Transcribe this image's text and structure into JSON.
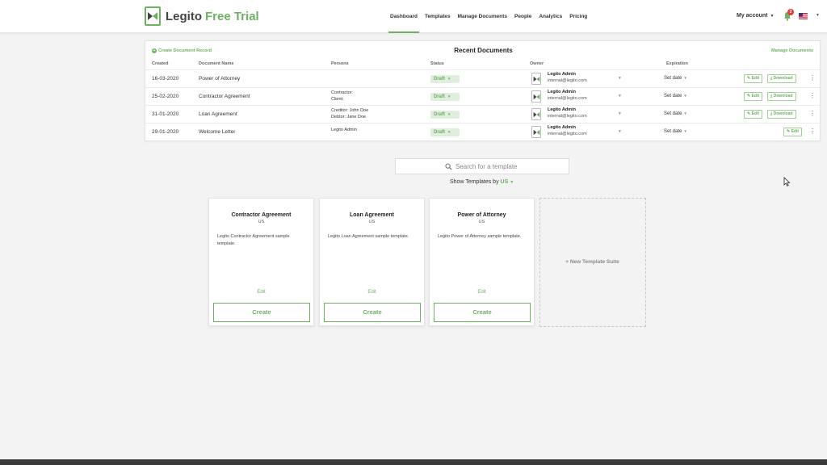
{
  "brand": {
    "name": "Legito",
    "suffix": "Free Trial"
  },
  "nav": [
    "Dashboard",
    "Templates",
    "Manage Documents",
    "People",
    "Analytics",
    "Pricing"
  ],
  "account": {
    "label": "My account",
    "notifications": "2"
  },
  "documents": {
    "create_label": "Create Document Record",
    "title": "Recent Documents",
    "manage_label": "Manage Documents",
    "columns": [
      "Created",
      "Document Name",
      "Persons",
      "Status",
      "Owner",
      "Expiration"
    ],
    "rows": [
      {
        "created": "16-03-2020",
        "name": "Power of Attorney",
        "persons": [
          "",
          ""
        ],
        "status": "Draft",
        "owner": "Legito Admin",
        "email": "internal@legito.com",
        "expiration": "Set date",
        "edit": "Edit",
        "download": "Download"
      },
      {
        "created": "25-02-2020",
        "name": "Contractor Agreement",
        "persons": [
          "Contractor:",
          "Client:"
        ],
        "status": "Draft",
        "owner": "Legito Admin",
        "email": "internal@legito.com",
        "expiration": "Set date",
        "edit": "Edit",
        "download": "Download"
      },
      {
        "created": "31-01-2020",
        "name": "Loan Agreement",
        "persons": [
          "Creditor: John Doe",
          "Debtor: Jane Doe"
        ],
        "status": "Draft",
        "owner": "Legito Admin",
        "email": "internal@legito.com",
        "expiration": "Set date",
        "edit": "Edit",
        "download": "Download"
      },
      {
        "created": "29-01-2020",
        "name": "Welcome Letter",
        "persons": [
          "Legito Admin",
          ""
        ],
        "status": "Draft",
        "owner": "Legito Admin",
        "email": "internal@legito.com",
        "expiration": "Set date",
        "edit": "Edit"
      }
    ]
  },
  "search": {
    "placeholder": "Search for a template"
  },
  "show_templates": {
    "label": "Show Templates by",
    "value": "US"
  },
  "templates": [
    {
      "title": "Contractor Agreement",
      "country": "US",
      "description": "Legito Contractor Agreement sample template.",
      "edit": "Edit",
      "create": "Create"
    },
    {
      "title": "Loan Agreement",
      "country": "US",
      "description": "Legito Loan Agreement sample template.",
      "edit": "Edit",
      "create": "Create"
    },
    {
      "title": "Power of Attorney",
      "country": "US",
      "description": "Legito Power of Attorney sample template.",
      "edit": "Edit",
      "create": "Create"
    }
  ],
  "new_suite_label": "New Template Suite",
  "colors": {
    "accent": "#6fb163",
    "badge": "#e23b3b"
  }
}
